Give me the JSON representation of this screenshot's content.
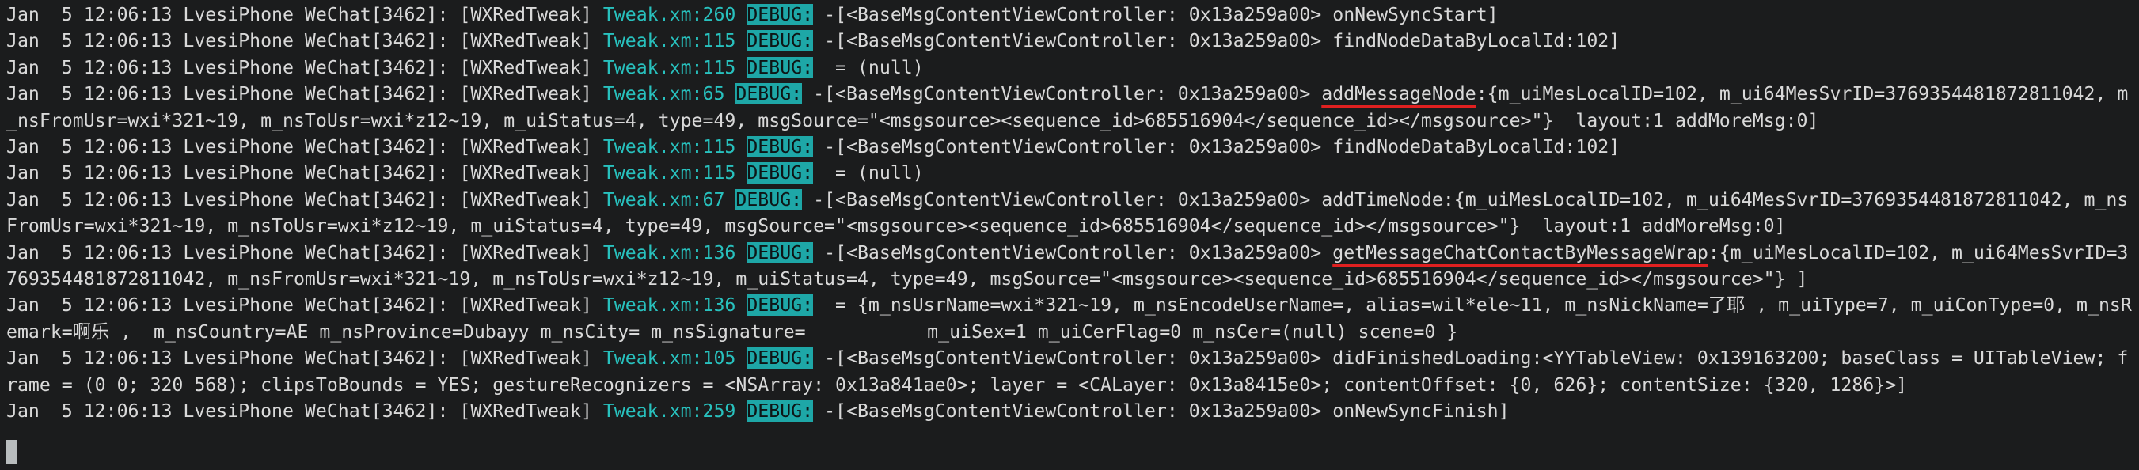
{
  "terminal": {
    "theme": {
      "background": "#1b1c1d",
      "text": "#d9d9d9",
      "file_color": "#28c1be",
      "debug_badge_bg": "#1ea7a7",
      "underline_color": "#e02020"
    },
    "lines": [
      {
        "segments": [
          {
            "t": "Jan  5 12:06:13 LvesiPhone WeChat[3462]: [WXRedTweak] "
          },
          {
            "t": "Tweak.xm:260",
            "s": "file"
          },
          {
            "t": " "
          },
          {
            "t": "DEBUG:",
            "s": "dbg"
          },
          {
            "t": " -[<BaseMsgContentViewController: 0x13a259a00> onNewSyncStart]"
          }
        ]
      },
      {
        "segments": [
          {
            "t": "Jan  5 12:06:13 LvesiPhone WeChat[3462]: [WXRedTweak] "
          },
          {
            "t": "Tweak.xm:115",
            "s": "file"
          },
          {
            "t": " "
          },
          {
            "t": "DEBUG:",
            "s": "dbg"
          },
          {
            "t": " -[<BaseMsgContentViewController: 0x13a259a00> findNodeDataByLocalId:102]"
          }
        ]
      },
      {
        "segments": [
          {
            "t": "Jan  5 12:06:13 LvesiPhone WeChat[3462]: [WXRedTweak] "
          },
          {
            "t": "Tweak.xm:115",
            "s": "file"
          },
          {
            "t": " "
          },
          {
            "t": "DEBUG:",
            "s": "dbg"
          },
          {
            "t": "  = (null)"
          }
        ]
      },
      {
        "segments": [
          {
            "t": "Jan  5 12:06:13 LvesiPhone WeChat[3462]: [WXRedTweak] "
          },
          {
            "t": "Tweak.xm:65",
            "s": "file"
          },
          {
            "t": " "
          },
          {
            "t": "DEBUG:",
            "s": "dbg"
          },
          {
            "t": " -[<BaseMsgContentViewController: 0x13a259a00> "
          },
          {
            "t": "addMessageNode",
            "s": "ul"
          },
          {
            "t": ":{m_uiMesLocalID=102, m_ui64MesSvrID=3769354481872811042, m"
          }
        ]
      },
      {
        "segments": [
          {
            "t": "_nsFromUsr=wxi*321~19, m_nsToUsr=wxi*z12~19, m_uiStatus=4, type=49, msgSource=\"<msgsource><sequence_id>685516904</sequence_id></msgsource>\"}  layout:1 addMoreMsg:0]"
          }
        ]
      },
      {
        "segments": [
          {
            "t": "Jan  5 12:06:13 LvesiPhone WeChat[3462]: [WXRedTweak] "
          },
          {
            "t": "Tweak.xm:115",
            "s": "file"
          },
          {
            "t": " "
          },
          {
            "t": "DEBUG:",
            "s": "dbg"
          },
          {
            "t": " -[<BaseMsgContentViewController: 0x13a259a00> findNodeDataByLocalId:102]"
          }
        ]
      },
      {
        "segments": [
          {
            "t": "Jan  5 12:06:13 LvesiPhone WeChat[3462]: [WXRedTweak] "
          },
          {
            "t": "Tweak.xm:115",
            "s": "file"
          },
          {
            "t": " "
          },
          {
            "t": "DEBUG:",
            "s": "dbg"
          },
          {
            "t": "  = (null)"
          }
        ]
      },
      {
        "segments": [
          {
            "t": "Jan  5 12:06:13 LvesiPhone WeChat[3462]: [WXRedTweak] "
          },
          {
            "t": "Tweak.xm:67",
            "s": "file"
          },
          {
            "t": " "
          },
          {
            "t": "DEBUG:",
            "s": "dbg"
          },
          {
            "t": " -[<BaseMsgContentViewController: 0x13a259a00> addTimeNode:{m_uiMesLocalID=102, m_ui64MesSvrID=3769354481872811042, m_ns"
          }
        ]
      },
      {
        "segments": [
          {
            "t": "FromUsr=wxi*321~19, m_nsToUsr=wxi*z12~19, m_uiStatus=4, type=49, msgSource=\"<msgsource><sequence_id>685516904</sequence_id></msgsource>\"}  layout:1 addMoreMsg:0]"
          }
        ]
      },
      {
        "segments": [
          {
            "t": "Jan  5 12:06:13 LvesiPhone WeChat[3462]: [WXRedTweak] "
          },
          {
            "t": "Tweak.xm:136",
            "s": "file"
          },
          {
            "t": " "
          },
          {
            "t": "DEBUG:",
            "s": "dbg"
          },
          {
            "t": " -[<BaseMsgContentViewController: 0x13a259a00> "
          },
          {
            "t": "getMessageChatContactByMessageWrap",
            "s": "ul"
          },
          {
            "t": ":{m_uiMesLocalID=102, m_ui64MesSvrID=3"
          }
        ]
      },
      {
        "segments": [
          {
            "t": "769354481872811042, m_nsFromUsr=wxi*321~19, m_nsToUsr=wxi*z12~19, m_uiStatus=4, type=49, msgSource=\"<msgsource><sequence_id>685516904</sequence_id></msgsource>\"} ]"
          }
        ]
      },
      {
        "segments": [
          {
            "t": "Jan  5 12:06:13 LvesiPhone WeChat[3462]: [WXRedTweak] "
          },
          {
            "t": "Tweak.xm:136",
            "s": "file"
          },
          {
            "t": " "
          },
          {
            "t": "DEBUG:",
            "s": "dbg"
          },
          {
            "t": "  = {m_nsUsrName=wxi*321~19, m_nsEncodeUserName=, alias=wil*ele~11, m_nsNickName=了耶 , m_uiType=7, m_uiConType=0, m_nsR"
          }
        ]
      },
      {
        "segments": [
          {
            "t": "emark=啊乐 ,  m_nsCountry=AE m_nsProvince=Dubayy m_nsCity= m_nsSignature=           m_uiSex=1 m_uiCerFlag=0 m_nsCer=(null) scene=0 }"
          }
        ]
      },
      {
        "segments": [
          {
            "t": "Jan  5 12:06:13 LvesiPhone WeChat[3462]: [WXRedTweak] "
          },
          {
            "t": "Tweak.xm:105",
            "s": "file"
          },
          {
            "t": " "
          },
          {
            "t": "DEBUG:",
            "s": "dbg"
          },
          {
            "t": " -[<BaseMsgContentViewController: 0x13a259a00> didFinishedLoading:<YYTableView: 0x139163200; baseClass = UITableView; f"
          }
        ]
      },
      {
        "segments": [
          {
            "t": "rame = (0 0; 320 568); clipsToBounds = YES; gestureRecognizers = <NSArray: 0x13a841ae0>; layer = <CALayer: 0x13a8415e0>; contentOffset: {0, 626}; contentSize: {320, 1286}>]"
          }
        ]
      },
      {
        "segments": [
          {
            "t": "Jan  5 12:06:13 LvesiPhone WeChat[3462]: [WXRedTweak] "
          },
          {
            "t": "Tweak.xm:259",
            "s": "file"
          },
          {
            "t": " "
          },
          {
            "t": "DEBUG:",
            "s": "dbg"
          },
          {
            "t": " -[<BaseMsgContentViewController: 0x13a259a00> onNewSyncFinish]"
          }
        ]
      }
    ]
  }
}
